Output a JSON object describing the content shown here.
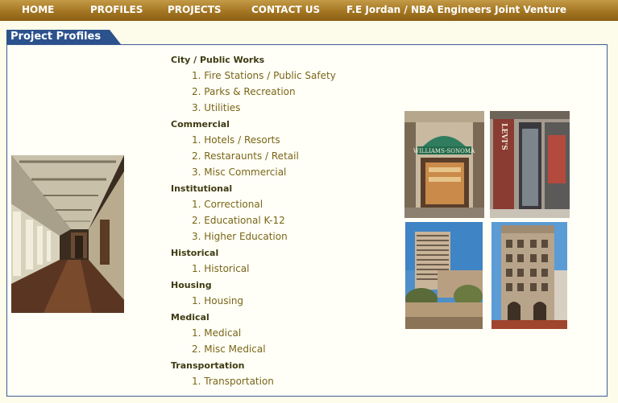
{
  "nav": {
    "items": [
      "HOME",
      "PROFILES",
      "PROJECTS",
      "CONTACT US",
      "F.E Jordan / NBA Engineers Joint Venture"
    ]
  },
  "section": {
    "title": "Project Profiles"
  },
  "categories": [
    {
      "name": "City / Public Works",
      "items": [
        "1. Fire Stations / Public Safety",
        "2. Parks & Recreation",
        "3. Utilities"
      ]
    },
    {
      "name": "Commercial",
      "items": [
        "1. Hotels / Resorts",
        "2. Restaraunts / Retail",
        "3. Misc Commercial"
      ]
    },
    {
      "name": "Institutional",
      "items": [
        "1. Correctional",
        "2. Educational K-12",
        "3. Higher Education"
      ]
    },
    {
      "name": "Historical",
      "items": [
        "1. Historical"
      ]
    },
    {
      "name": "Housing",
      "items": [
        "1. Housing"
      ]
    },
    {
      "name": "Medical",
      "items": [
        "1. Medical",
        "2. Misc Medical"
      ]
    },
    {
      "name": "Transportation",
      "items": [
        "1. Transportation"
      ]
    }
  ],
  "photos": {
    "storefront_sign": "WILLIAMS-SONOMA",
    "levis_sign": "LEVI'S"
  },
  "colors": {
    "nav_gradient_top": "#c39a45",
    "nav_gradient_bottom": "#8a5f14",
    "section_tab": "#2c528d",
    "category_text": "#3e3a12",
    "link_text": "#7a6518",
    "background": "#fdfbea"
  }
}
